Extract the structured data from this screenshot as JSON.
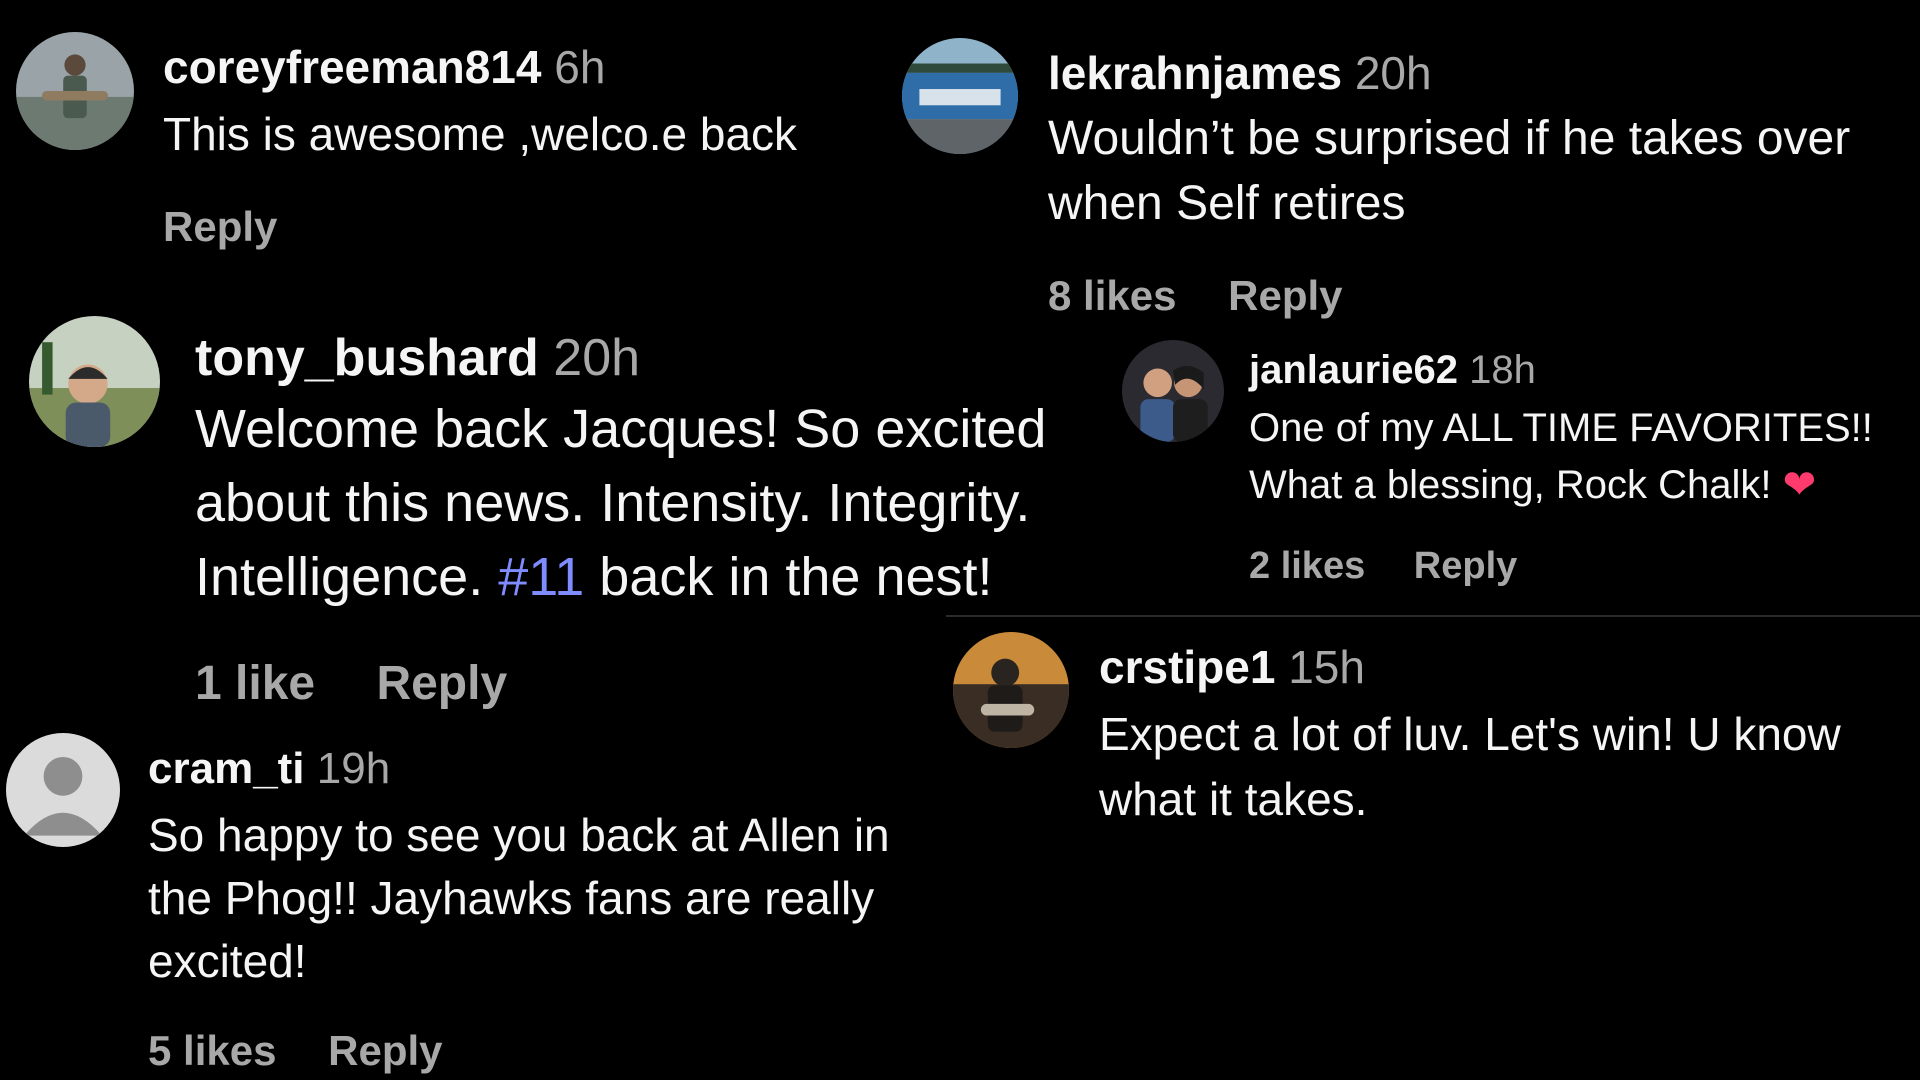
{
  "colors": {
    "background": "#000000",
    "text": "#f5f5f5",
    "muted": "#a8a8a8",
    "hashtag": "#7f8cff",
    "heart": "#ff3b6e"
  },
  "comments": [
    {
      "username": "coreyfreeman814",
      "time": "6h",
      "lines": [
        "This is awesome ,welco.e back"
      ],
      "likes": "",
      "reply": "Reply",
      "avatar_icon": "fisherman-photo-avatar"
    },
    {
      "username": "lekrahnjames",
      "time": "20h",
      "lines": [
        "Wouldn’t be surprised if he takes over",
        "when Self retires"
      ],
      "likes": "8 likes",
      "reply": "Reply",
      "avatar_icon": "building-photo-avatar"
    },
    {
      "username": "tony_bushard",
      "time": "20h",
      "lines": [
        "Welcome back Jacques! So excited",
        "about this news. Intensity. Integrity."
      ],
      "line3_pre": "Intelligence. ",
      "hashtag": "#11",
      "line3_post": " back in the nest!",
      "likes": "1 like",
      "reply": "Reply",
      "avatar_icon": "man-outdoors-photo-avatar"
    },
    {
      "username": "janlaurie62",
      "time": "18h",
      "lines": [
        "One of my ALL TIME FAVORITES!!"
      ],
      "line2_pre": "What a blessing, Rock Chalk! ",
      "emoji": "❤",
      "likes": "2 likes",
      "reply": "Reply",
      "avatar_icon": "couple-photo-avatar"
    },
    {
      "username": "crstipe1",
      "time": "15h",
      "lines": [
        "Expect a lot of luv. Let's win! U know",
        "what it takes."
      ],
      "likes": "",
      "reply": "",
      "avatar_icon": "sunset-photo-avatar"
    },
    {
      "username": "cram_ti",
      "time": "19h",
      "lines": [
        "So happy to see you back at Allen in",
        "the Phog!! Jayhawks fans are really",
        "excited!"
      ],
      "likes": "5 likes",
      "reply": "Reply",
      "avatar_icon": "default-user-avatar"
    }
  ]
}
